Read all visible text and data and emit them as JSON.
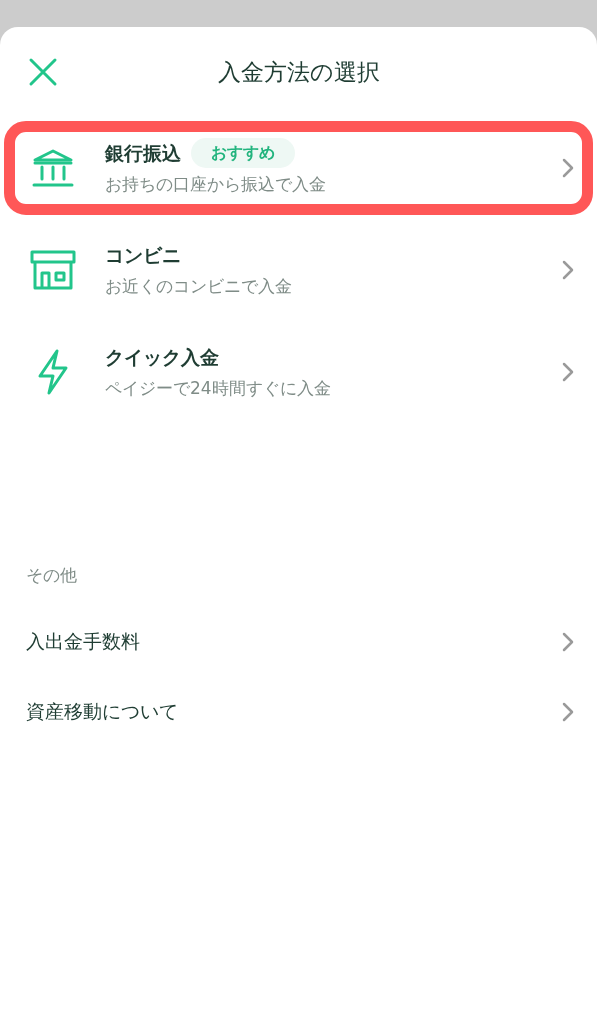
{
  "sheet": {
    "title": "入金方法の選択"
  },
  "methods": [
    {
      "kind": "bank",
      "title": "銀行振込",
      "badge": "おすすめ",
      "description": "お持ちの口座から振込で入金",
      "highlighted": true
    },
    {
      "kind": "store",
      "title": "コンビニ",
      "description": "お近くのコンビニで入金",
      "highlighted": false
    },
    {
      "kind": "quick",
      "title": "クイック入金",
      "description": "ペイジーで24時間すぐに入金",
      "highlighted": false
    }
  ],
  "other": {
    "heading": "その他",
    "links": [
      "入出金手数料",
      "資産移動について"
    ]
  }
}
